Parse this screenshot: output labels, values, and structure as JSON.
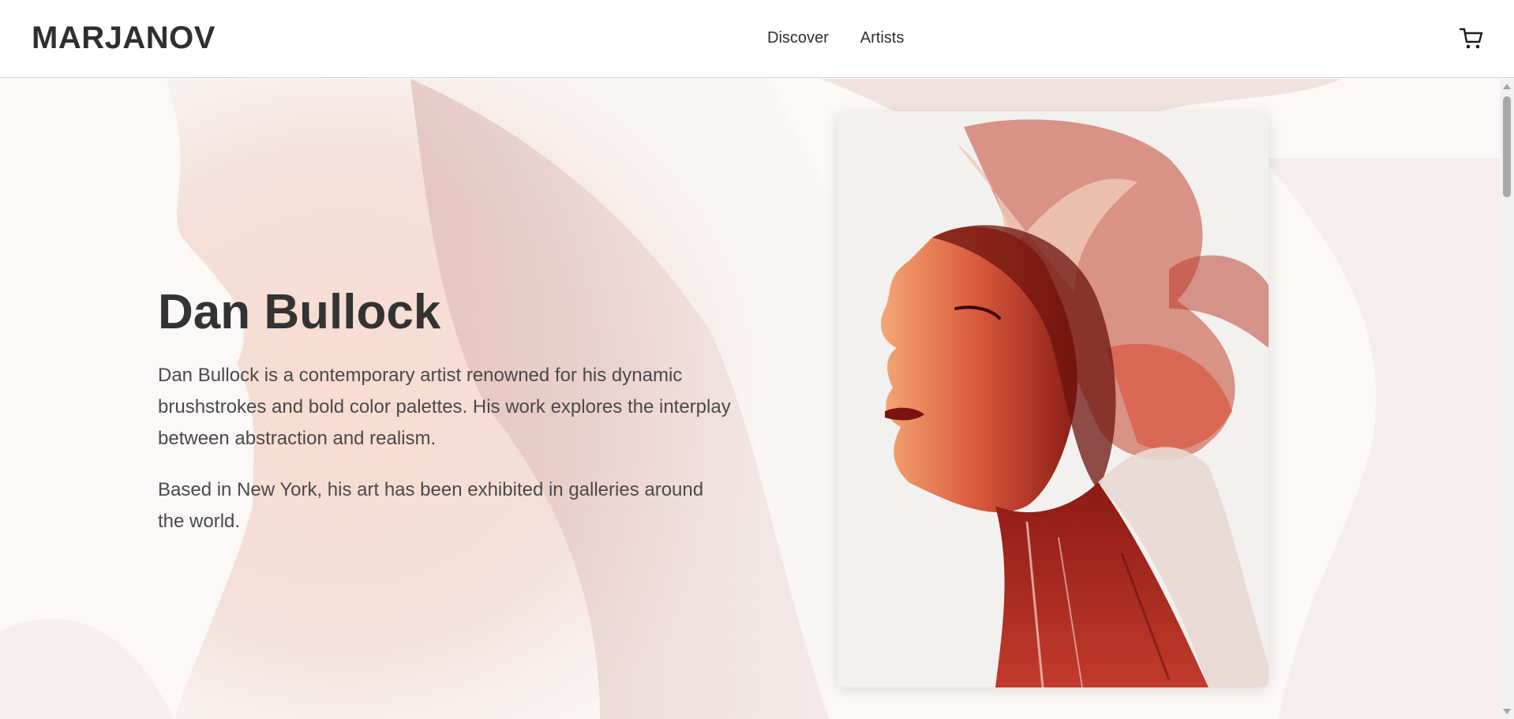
{
  "header": {
    "logo": "MARJANOV",
    "nav": [
      {
        "label": "Discover"
      },
      {
        "label": "Artists"
      }
    ],
    "cart_icon": "shopping-cart-icon"
  },
  "artist": {
    "name": "Dan Bullock",
    "bio": [
      "Dan Bullock is a contemporary artist renowned for his dynamic brushstrokes and bold color palettes. His work explores the interplay between abstraction and realism.",
      "Based in New York, his art has been exhibited in galleries around the world."
    ]
  },
  "colors": {
    "text": "#2f2f2f",
    "paint_red": "#a8201a",
    "paint_dark": "#5a0f0c",
    "paint_orange": "#e8894e",
    "canvas": "#f2f1ef"
  }
}
